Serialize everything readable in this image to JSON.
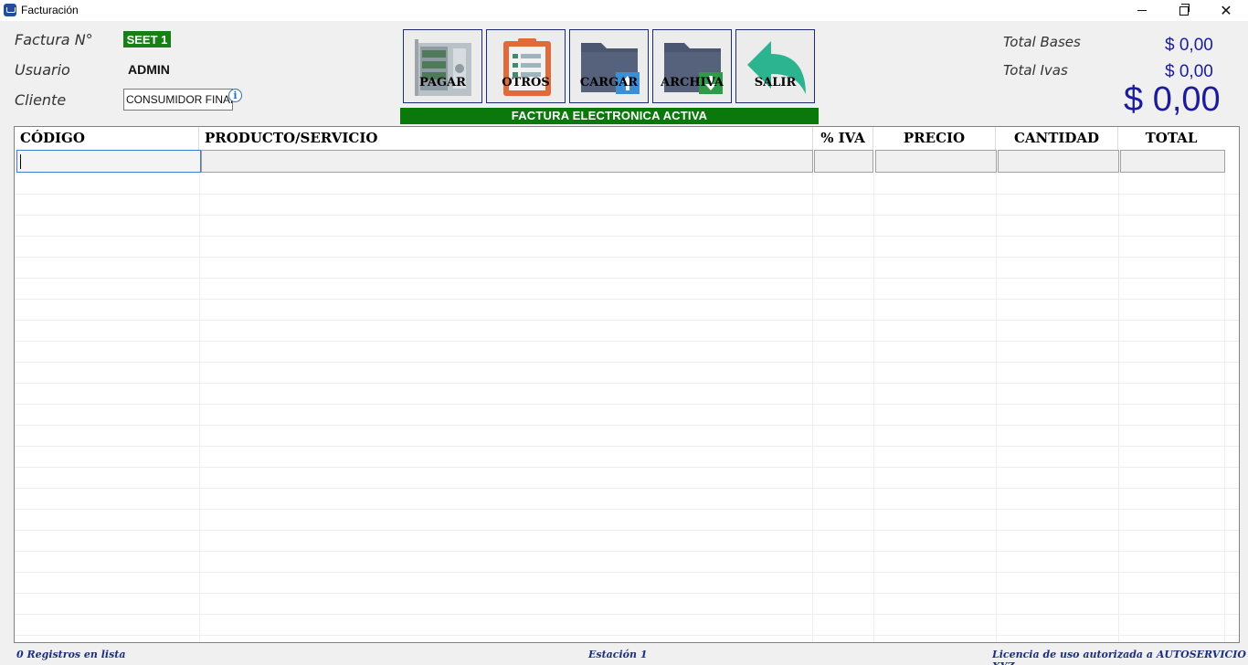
{
  "window": {
    "title": "Facturación",
    "minimize_label": "",
    "maximize_label": "",
    "close_label": "✕"
  },
  "info": {
    "invoice_label": "Factura N°",
    "invoice_number": "SEET 1",
    "user_label": "Usuario",
    "user_value": "ADMIN",
    "client_label": "Cliente",
    "client_value": "CONSUMIDOR FINAL",
    "info_glyph": "i"
  },
  "toolbar": {
    "buttons": [
      {
        "label": "PAGAR",
        "icon": "safe-icon"
      },
      {
        "label": "OTROS",
        "icon": "clipboard-icon"
      },
      {
        "label": "CARGAR",
        "icon": "folder-upload-icon"
      },
      {
        "label": "ARCHIVA",
        "icon": "folder-download-icon"
      },
      {
        "label": "SALIR",
        "icon": "back-arrow-icon"
      }
    ],
    "banner": "FACTURA ELECTRONICA ACTIVA"
  },
  "totals": {
    "bases_label": "Total Bases",
    "bases_value": "$ 0,00",
    "ivas_label": "Total Ivas",
    "ivas_value": "$ 0,00",
    "grand_total": "$ 0,00"
  },
  "grid": {
    "columns": [
      "CÓDIGO",
      "PRODUCTO/SERVICIO",
      "% IVA",
      "PRECIO",
      "CANTIDAD",
      "TOTAL"
    ],
    "rows": []
  },
  "status": {
    "records": "0 Registros en lista",
    "station": "Estación 1",
    "license": "Licencia de uso autorizada a AUTOSERVICIO XYZ"
  },
  "colors": {
    "accent_green": "#0a780a",
    "value_blue": "#1c1c9a",
    "status_blue": "#1c2f7d",
    "button_border": "#1a2d73"
  }
}
